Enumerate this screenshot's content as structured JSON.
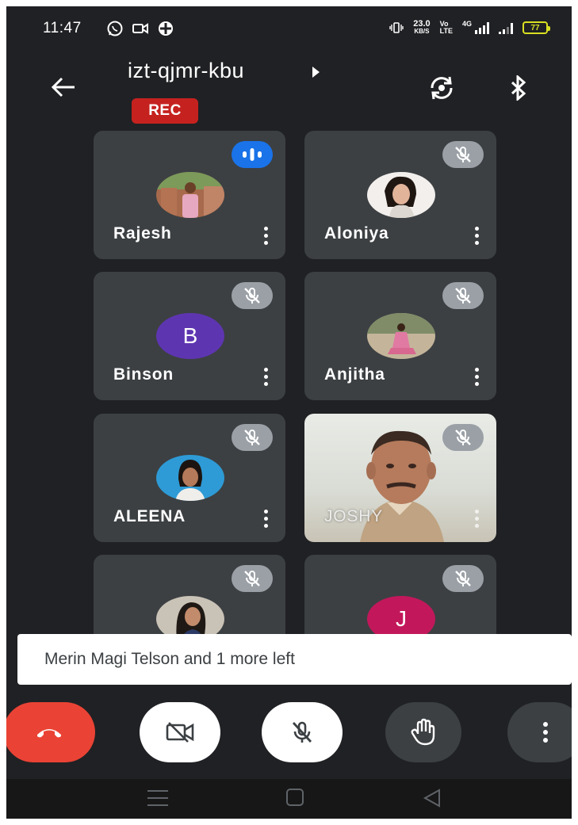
{
  "status_bar": {
    "time": "11:47",
    "speed_value": "23.0",
    "speed_unit": "KB/S",
    "volte_top": "Vo",
    "volte_bottom": "LTE",
    "net_type": "4G",
    "battery": "77"
  },
  "header": {
    "meeting_code": "izt-qjmr-kbu",
    "rec_label": "REC"
  },
  "participants": [
    {
      "name": "Rajesh",
      "status": "speaking"
    },
    {
      "name": "Aloniya",
      "status": "muted"
    },
    {
      "name": "Binson",
      "status": "muted",
      "initial": "B",
      "avatar_color": "#5e35b1"
    },
    {
      "name": "Anjitha",
      "status": "muted"
    },
    {
      "name": "ALEENA",
      "status": "muted"
    },
    {
      "name": "JOSHY",
      "status": "muted"
    },
    {
      "name": "",
      "status": "muted"
    },
    {
      "name": "",
      "status": "muted",
      "initial": "J",
      "avatar_color": "#c2185b"
    }
  ],
  "toast": {
    "message": "Merin Magi Telson and 1 more left"
  },
  "colors": {
    "background": "#202124",
    "tile": "#3c4043",
    "end_call": "#ea4335",
    "rec": "#c5221f",
    "speaking": "#1a73e8"
  },
  "icons": {
    "back": "arrow-left-icon",
    "switch_camera": "camera-switch-icon",
    "bluetooth": "bluetooth-icon",
    "mute": "mic-off-icon",
    "end_call": "phone-hangup-icon",
    "camera_off": "camera-off-icon",
    "raise_hand": "hand-icon",
    "more": "more-vert-icon"
  }
}
